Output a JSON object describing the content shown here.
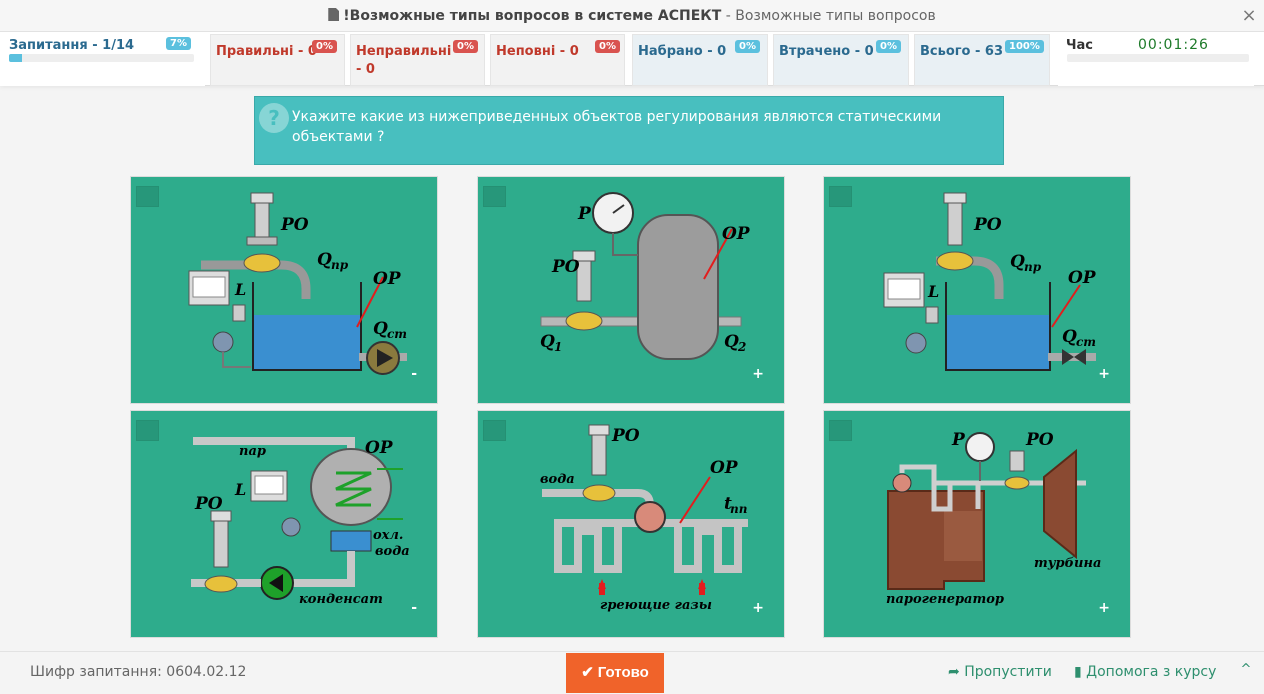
{
  "window": {
    "title": "!Возможные типы вопросов в системе АСПЕКТ",
    "subtitle": " - Возможные типы вопросов",
    "close": "×"
  },
  "stats": {
    "progress": {
      "label": "Запитання - 1/14",
      "badge": "7%",
      "fraction": 0.07
    },
    "correct": {
      "label": "Правильні - 0",
      "badge": "0%"
    },
    "wrong": {
      "label": "Неправильні - 0",
      "badge": "0%"
    },
    "partial": {
      "label": "Неповні - 0",
      "badge": "0%"
    },
    "scored": {
      "label": "Набрано - 0",
      "badge": "0%"
    },
    "lost": {
      "label": "Втрачено - 0",
      "badge": "0%"
    },
    "total": {
      "label": "Всього - 63",
      "badge": "100%"
    },
    "time": {
      "label": "Час",
      "value": "00:01:26"
    }
  },
  "question": {
    "icon": "?",
    "text": "Укажите какие из нижеприведенных объектов регулирования являются статическими объектами ?"
  },
  "cards": [
    {
      "expand": "-",
      "labels": {
        "ro": "РО",
        "qpr": "Q",
        "qpr_sub": "пр",
        "op": "ОР",
        "l": "L",
        "qst": "Q",
        "qst_sub": "ст"
      }
    },
    {
      "expand": "+",
      "labels": {
        "p": "P",
        "ro": "РО",
        "op": "ОР",
        "q1": "Q",
        "q1_sub": "1",
        "q2": "Q",
        "q2_sub": "2"
      }
    },
    {
      "expand": "+",
      "labels": {
        "ro": "РО",
        "qpr": "Q",
        "qpr_sub": "пр",
        "op": "ОР",
        "l": "L",
        "qst": "Q",
        "qst_sub": "ст"
      }
    },
    {
      "expand": "-",
      "labels": {
        "par": "пар",
        "op": "ОР",
        "l": "L",
        "ro": "РО",
        "ohl": "охл.",
        "voda": "вода",
        "kond": "конденсат"
      }
    },
    {
      "expand": "+",
      "labels": {
        "ro": "РО",
        "voda": "вода",
        "op": "ОР",
        "t": "t",
        "t_sub": "пп",
        "gases": "греющие газы"
      }
    },
    {
      "expand": "+",
      "labels": {
        "p": "P",
        "ro": "РО",
        "turb": "турбина",
        "pg": "парогенератор"
      }
    }
  ],
  "footer": {
    "cipher": "Шифр запитання: 0604.02.12",
    "ready": "Готово",
    "ready_icon": "✔",
    "skip": "Пропустити",
    "skip_icon": "➦",
    "help": "Допомога з курсу",
    "help_icon": "▮",
    "up_icon": "^"
  },
  "colors": {
    "card_bg": "#2eac8c",
    "question_bg": "#48bfbf",
    "ready_btn": "#f0632a",
    "link": "#2e8f6e"
  }
}
